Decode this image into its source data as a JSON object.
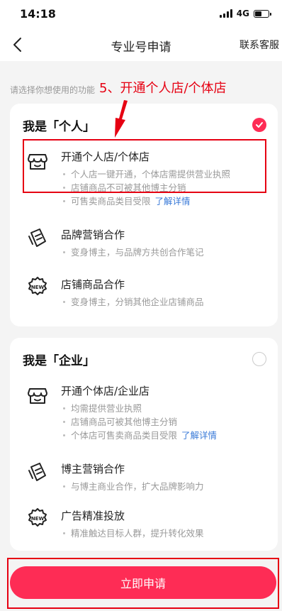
{
  "status_bar": {
    "time": "14:18",
    "network": "4G"
  },
  "nav": {
    "title": "专业号申请",
    "action": "联系客服"
  },
  "prompt": "请选择你想使用的功能",
  "annotation": "5、开通个人店/个体店",
  "personal": {
    "title": "我是「个人」",
    "options": [
      {
        "title": "开通个人店/个体店",
        "bullets": [
          "个人店一键开通，个体店需提供营业执照",
          "店铺商品不可被其他博主分销",
          "可售卖商品类目受限"
        ],
        "link": "了解详情"
      },
      {
        "title": "品牌营销合作",
        "bullets": [
          "变身博主，与品牌方共创合作笔记"
        ]
      },
      {
        "title": "店铺商品合作",
        "bullets": [
          "变身博主，分销其他企业店铺商品"
        ]
      }
    ]
  },
  "enterprise": {
    "title": "我是「企业」",
    "options": [
      {
        "title": "开通个体店/企业店",
        "bullets": [
          "均需提供营业执照",
          "店铺商品可被其他博主分销",
          "个体店可售卖商品类目受限"
        ],
        "link": "了解详情"
      },
      {
        "title": "博主营销合作",
        "bullets": [
          "与博主商业合作，扩大品牌影响力"
        ]
      },
      {
        "title": "广告精准投放",
        "bullets": [
          "精准触达目标人群，提升转化效果"
        ]
      }
    ]
  },
  "apply_button": "立即申请",
  "colors": {
    "accent": "#fe2c55",
    "annotation": "#e60012",
    "link": "#3b7bd8"
  }
}
